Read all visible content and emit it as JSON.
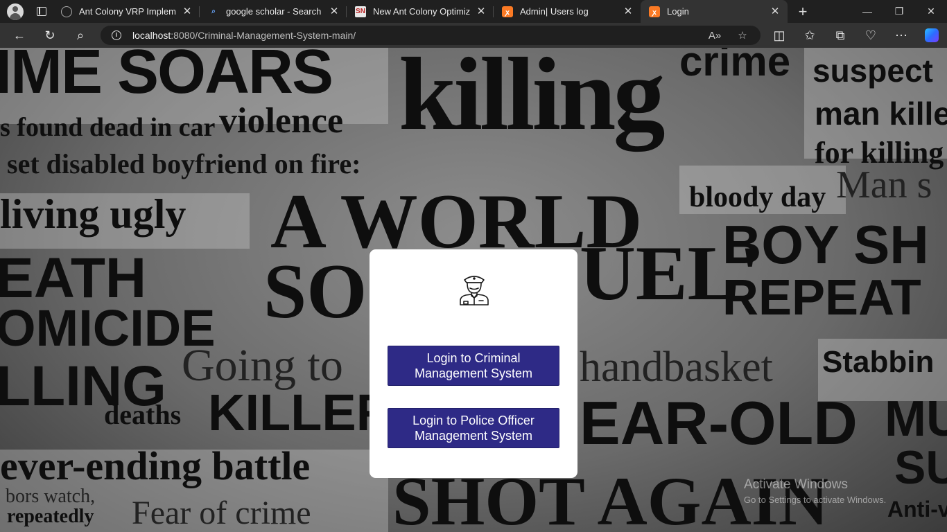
{
  "browser": {
    "tabs": [
      {
        "title": "Ant Colony VRP Implementa",
        "favicon": "ai-chat-icon",
        "active": false
      },
      {
        "title": "google scholar - Search",
        "favicon": "search-icon",
        "active": false
      },
      {
        "title": "New Ant Colony Optimizatio",
        "favicon": "sn-icon",
        "active": false
      },
      {
        "title": "Admin| Users log",
        "favicon": "xampp-icon",
        "active": false
      },
      {
        "title": "Login",
        "favicon": "xampp-icon",
        "active": true
      }
    ],
    "address_host": "localhost",
    "address_rest": ":8080/Criminal-Management-System-main/"
  },
  "login_card": {
    "icon": "police-officer-icon",
    "buttons": [
      {
        "label": "Login to Criminal Management System"
      },
      {
        "label": "Login to Police Officer Management System"
      }
    ]
  },
  "background_headlines": [
    "IME SOARS",
    "killing",
    "crime",
    "suspect",
    "s found dead in car",
    "violence",
    "man kille",
    "set disabled boyfriend on fire:",
    "for killing",
    "living ugly",
    "bloody day",
    "Man s",
    "A WORLD",
    "BOY SH",
    "EATH",
    "SO",
    "UEL'",
    "REPEAT",
    "OMICIDE",
    "LLING",
    "Going to",
    "handbasket",
    "Stabbin",
    "deaths",
    "KILLER",
    "EAR-OLD",
    "MU",
    "ever-ending battle",
    "SU",
    "SHOT AGAIN",
    "bors watch,",
    "repeatedly",
    "Fear of crime",
    "Anti-vi"
  ],
  "watermark": {
    "title": "Activate Windows",
    "subtitle": "Go to Settings to activate Windows."
  },
  "colors": {
    "button_bg": "#2e2a86",
    "card_bg": "#ffffff",
    "browser_chrome": "#202020"
  }
}
